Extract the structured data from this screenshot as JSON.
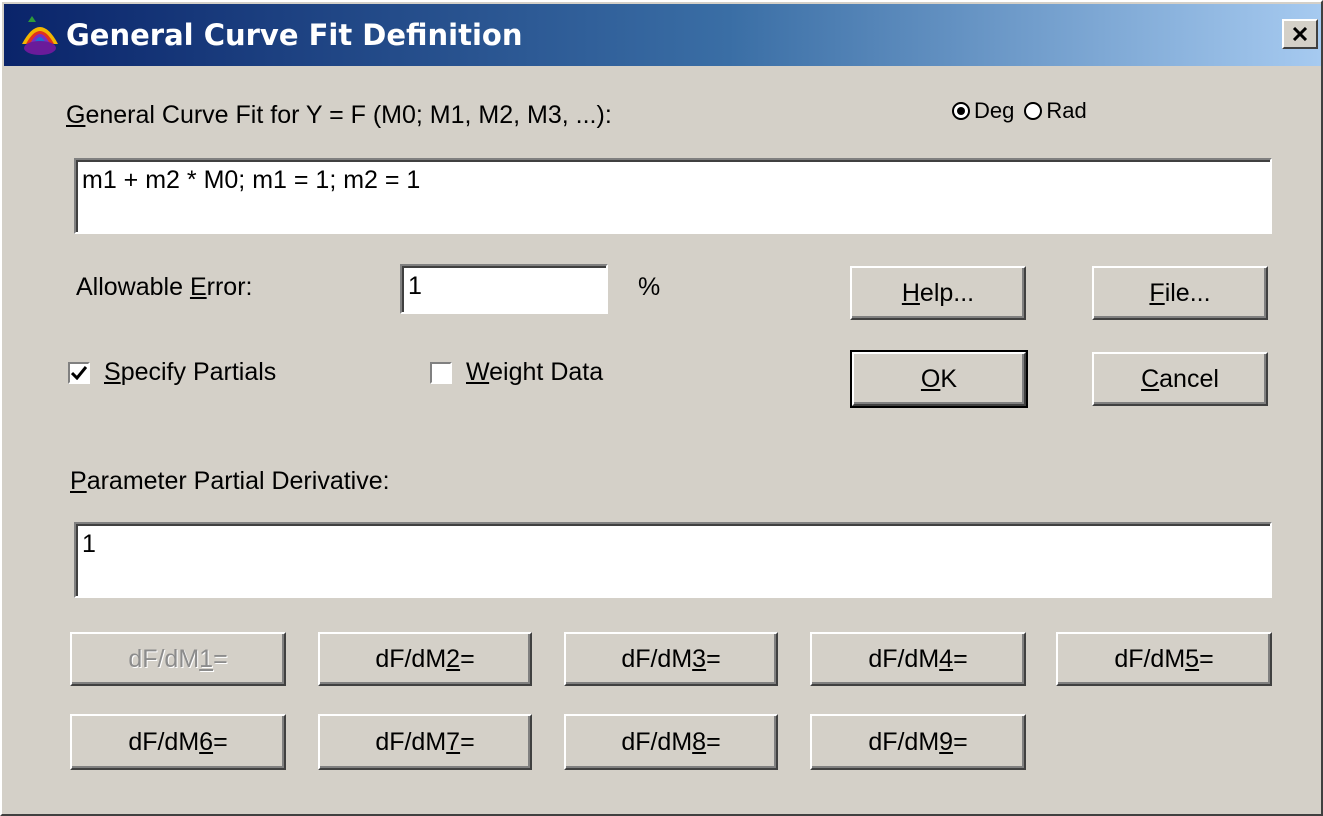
{
  "window": {
    "title": "General Curve Fit Definition"
  },
  "formula": {
    "label_accel": "G",
    "label_rest": "eneral Curve Fit for Y = F (M0;  M1, M2, M3, ...):",
    "value": "m1 + m2 * M0; m1 = 1; m2 = 1"
  },
  "angle_mode": {
    "options": [
      {
        "label": "Deg",
        "selected": true
      },
      {
        "label": "Rad",
        "selected": false
      }
    ]
  },
  "error": {
    "label_pre": "Allowable ",
    "label_accel": "E",
    "label_post": "rror:",
    "value": "1",
    "unit": "%"
  },
  "options": {
    "specify_partials": {
      "accel": "S",
      "rest": "pecify Partials",
      "checked": true
    },
    "weight_data": {
      "accel": "W",
      "rest": "eight Data",
      "checked": false
    }
  },
  "buttons": {
    "help": {
      "accel": "H",
      "rest": "elp..."
    },
    "file": {
      "accel": "F",
      "rest": "ile..."
    },
    "ok": {
      "accel": "O",
      "rest": "K"
    },
    "cancel": {
      "accel": "C",
      "rest": "ancel"
    }
  },
  "partial": {
    "label_accel": "P",
    "label_rest": "arameter Partial Derivative:",
    "value": "1"
  },
  "derivatives": [
    {
      "pre": "dF/dM",
      "accel": "1",
      "post": " =",
      "enabled": false
    },
    {
      "pre": "dF/dM",
      "accel": "2",
      "post": " =",
      "enabled": true
    },
    {
      "pre": "dF/dM",
      "accel": "3",
      "post": " =",
      "enabled": true
    },
    {
      "pre": "dF/dM",
      "accel": "4",
      "post": " =",
      "enabled": true
    },
    {
      "pre": "dF/dM",
      "accel": "5",
      "post": " =",
      "enabled": true
    },
    {
      "pre": "dF/dM",
      "accel": "6",
      "post": " =",
      "enabled": true
    },
    {
      "pre": "dF/dM",
      "accel": "7",
      "post": " =",
      "enabled": true
    },
    {
      "pre": "dF/dM",
      "accel": "8",
      "post": " =",
      "enabled": true
    },
    {
      "pre": "dF/dM",
      "accel": "9",
      "post": " =",
      "enabled": true
    }
  ],
  "colors": {
    "title_gradient_start": "#0a246a",
    "title_gradient_end": "#a6caf0",
    "dialog_face": "#d4d0c8"
  }
}
